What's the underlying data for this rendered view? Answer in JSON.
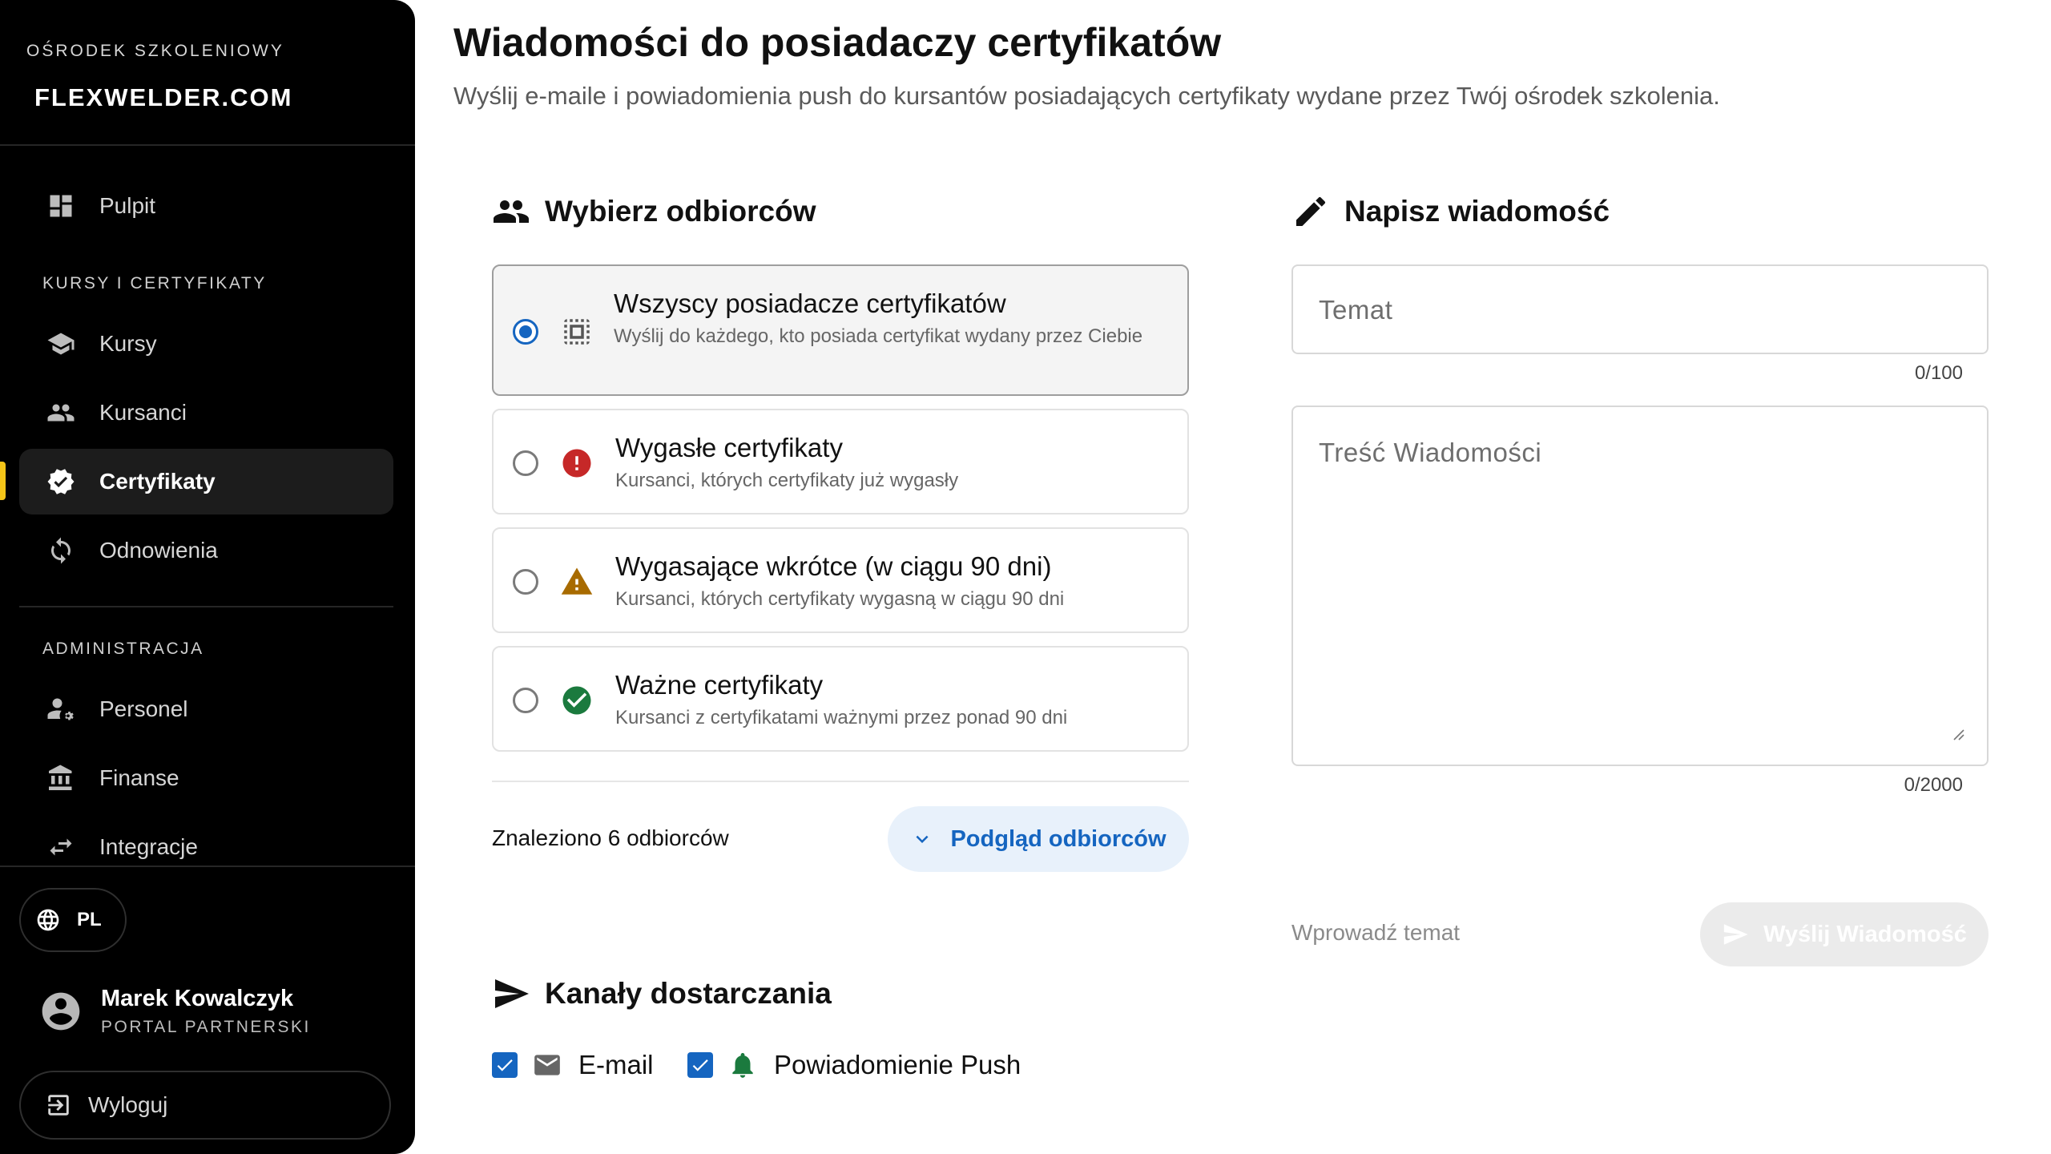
{
  "sidebar": {
    "org_label": "OŚRODEK SZKOLENIOWY",
    "brand": "FLEXWELDER.COM",
    "nav": [
      {
        "label": "Pulpit",
        "icon": "dashboard-icon"
      },
      {
        "label": "Kursy",
        "icon": "school-icon"
      },
      {
        "label": "Kursanci",
        "icon": "people-icon"
      },
      {
        "label": "Certyfikaty",
        "icon": "verified-badge-icon",
        "active": true
      },
      {
        "label": "Odnowienia",
        "icon": "refresh-icon"
      },
      {
        "label": "Personel",
        "icon": "staff-gear-icon"
      },
      {
        "label": "Finanse",
        "icon": "bank-icon"
      },
      {
        "label": "Integracje",
        "icon": "swap-arrows-icon"
      }
    ],
    "section_courses": "KURSY I CERTYFIKATY",
    "section_admin": "ADMINISTRACJA",
    "lang": "PL",
    "user": {
      "name": "Marek Kowalczyk",
      "role": "PORTAL PARTNERSKI"
    },
    "logout": "Wyloguj",
    "accent": "#f5c518"
  },
  "main": {
    "title": "Wiadomości do posiadaczy certyfikatów",
    "subtitle": "Wyślij e-maile i powiadomienia push do kursantów posiadających certyfikaty wydane przez Twój ośrodek szkolenia.",
    "recipients": {
      "heading": "Wybierz odbiorców",
      "options": [
        {
          "title": "Wszyscy posiadacze certyfikatów",
          "desc": "Wyślij do każdego, kto posiada certyfikat wydany przez Ciebie",
          "icon": "select-all-icon",
          "selected": true
        },
        {
          "title": "Wygasłe certyfikaty",
          "desc": "Kursanci, których certyfikaty już wygasły",
          "icon": "error-icon",
          "color": "#c62828"
        },
        {
          "title": "Wygasające wkrótce (w ciągu 90 dni)",
          "desc": "Kursanci, których certyfikaty wygasną w ciągu 90 dni",
          "icon": "warning-icon",
          "color": "#a86b00"
        },
        {
          "title": "Ważne certyfikaty",
          "desc": "Kursanci z certyfikatami ważnymi przez ponad 90 dni",
          "icon": "check-circle-icon",
          "color": "#1b7a3e"
        }
      ],
      "found": "Znaleziono 6 odbiorców",
      "preview_button": "Podgląd odbiorców"
    },
    "channels": {
      "heading": "Kanały dostarczania",
      "email": {
        "label": "E-mail",
        "checked": true
      },
      "push": {
        "label": "Powiadomienie Push",
        "checked": true
      }
    },
    "compose": {
      "heading": "Napisz wiadomość",
      "subject_placeholder": "Temat",
      "subject_counter": "0/100",
      "body_placeholder": "Treść Wiadomości",
      "body_counter": "0/2000",
      "hint": "Wprowadź temat",
      "send_button": "Wyślij Wiadomość"
    },
    "accent": "#1565c0"
  }
}
